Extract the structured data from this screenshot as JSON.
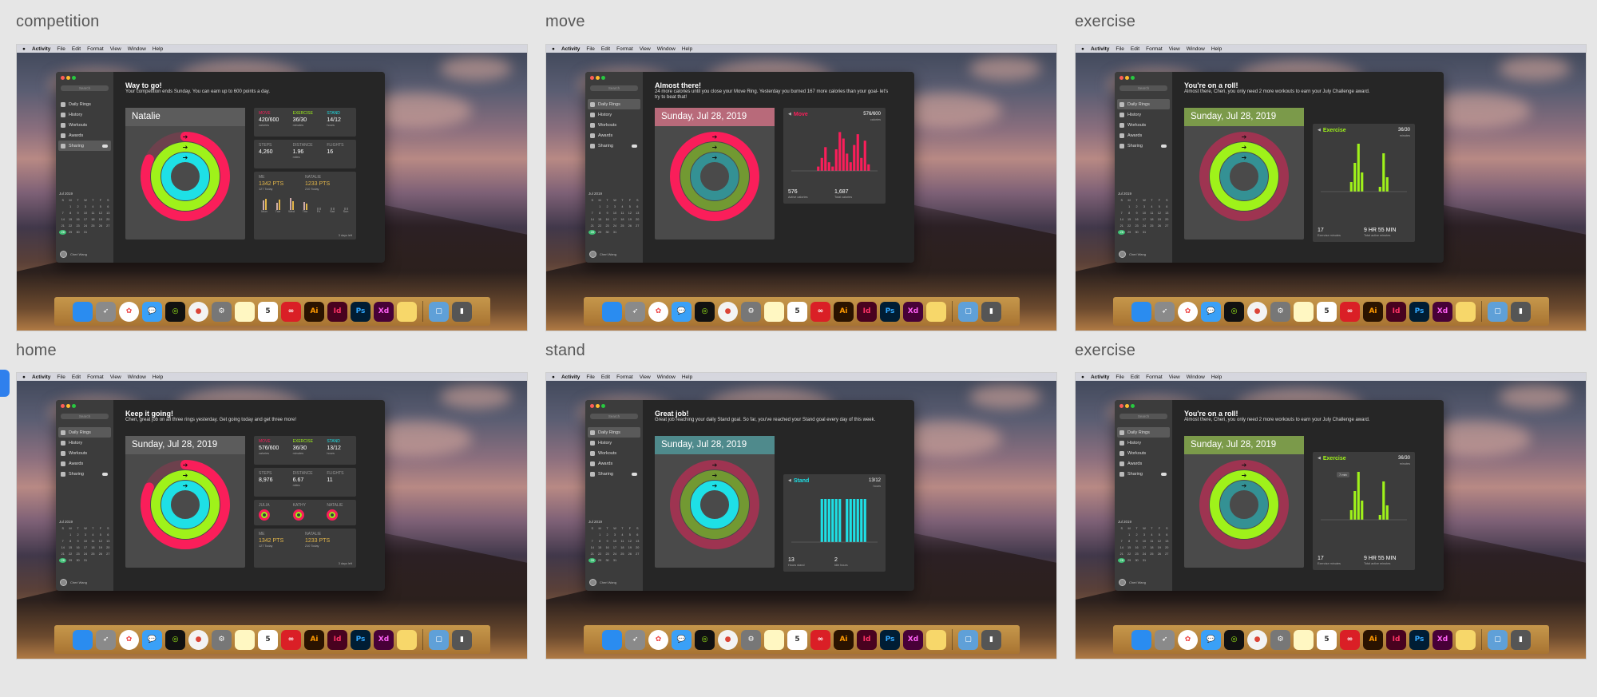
{
  "colors": {
    "move": "#fa1e5a",
    "exercise": "#9ff21a",
    "stand": "#1ee0e6",
    "window": "#262626",
    "sidebar": "#3c3c3c"
  },
  "menubar": {
    "app": "Activity",
    "items": [
      "File",
      "Edit",
      "Format",
      "View",
      "Window",
      "Help"
    ]
  },
  "sidebar": {
    "search_placeholder": "Search",
    "items": [
      {
        "label": "Daily Rings",
        "icon": "rings-icon"
      },
      {
        "label": "History",
        "icon": "history-icon"
      },
      {
        "label": "Workouts",
        "icon": "workout-icon"
      },
      {
        "label": "Awards",
        "icon": "star-icon"
      },
      {
        "label": "Sharing",
        "icon": "sharing-icon"
      }
    ],
    "calendar": {
      "month": "Jul 2019",
      "weekdays": [
        "S",
        "M",
        "T",
        "W",
        "T",
        "F",
        "S"
      ],
      "days": [
        "",
        "1",
        "2",
        "3",
        "4",
        "5",
        "6",
        "7",
        "8",
        "9",
        "10",
        "11",
        "12",
        "13",
        "14",
        "15",
        "16",
        "17",
        "18",
        "19",
        "20",
        "21",
        "22",
        "23",
        "24",
        "25",
        "26",
        "27",
        "28",
        "29",
        "30",
        "31",
        "",
        ""
      ]
    },
    "user": "Cheri Wang"
  },
  "dock": [
    "Finder",
    "Launchpad",
    "Photos",
    "Messages",
    "Activity",
    "Chrome",
    "System Preferences",
    "Notes",
    "Calendar",
    "Creative Cloud",
    "Ai",
    "Id",
    "Ps",
    "Xd",
    "Stickies",
    "Downloads",
    "Trash"
  ],
  "frames": [
    {
      "name": "competition",
      "heading": "Way to go!",
      "subtext": "Your competition ends Sunday. You can earn up to 600 points a day.",
      "card_title": "Natalie",
      "active": "Sharing",
      "metrics": [
        {
          "label": "MOVE",
          "value": "420/600",
          "unit": "calories"
        },
        {
          "label": "EXERCISE",
          "value": "36/30",
          "unit": "minutes"
        },
        {
          "label": "STAND",
          "value": "14/12",
          "unit": "hours"
        }
      ],
      "metrics2": [
        {
          "label": "STEPS",
          "value": "4,260",
          "unit": ""
        },
        {
          "label": "DISTANCE",
          "value": "1.96",
          "unit": "miles"
        },
        {
          "label": "FLIGHTS",
          "value": "16",
          "unit": ""
        }
      ],
      "competition": {
        "me_label": "ME",
        "me_pts": "1342 PTS",
        "me_today": "127 Today",
        "them_label": "NATALIE",
        "them_pts": "1233 PTS",
        "them_today": "210 Today",
        "days": [
          "Mon",
          "Tue",
          "Wed",
          "Thu",
          "Fri",
          "Sat",
          "Sun"
        ],
        "footer": "3 days left"
      }
    },
    {
      "name": "move",
      "heading": "Almost there!",
      "subtext": "24 more calories until you close your Move Ring. Yesterday you burned 167 more calories than your goal- let's try to beat that!",
      "card_title": "Sunday, Jul 28, 2019",
      "active": "Daily Rings",
      "detail": {
        "title": "Move",
        "value": "576/600",
        "unit": "calories",
        "stat1": "576",
        "stat1_label": "Active calories",
        "stat2": "1,687",
        "stat2_label": "Total calories"
      }
    },
    {
      "name": "exercise",
      "heading": "You're on a roll!",
      "subtext": "Almost there, Cheri, you only need 2 more workouts to earn your July Challenge award.",
      "card_title": "Sunday, Jul 28, 2019",
      "active": "Daily Rings",
      "detail": {
        "title": "Exercise",
        "value": "36/30",
        "unit": "minutes",
        "stat1": "17",
        "stat1_label": "Exercise minutes",
        "stat2": "9 HR 55 MIN",
        "stat2_label": "Total active minutes"
      }
    },
    {
      "name": "home",
      "heading": "Keep it going!",
      "subtext": "Cheri, great job on all three rings yesterday. Get going today and get three more!",
      "card_title": "Sunday, Jul 28, 2019",
      "active": "Daily Rings",
      "metrics": [
        {
          "label": "MOVE",
          "value": "576/600",
          "unit": "calories"
        },
        {
          "label": "EXERCISE",
          "value": "36/30",
          "unit": "minutes"
        },
        {
          "label": "STAND",
          "value": "13/12",
          "unit": "hours"
        }
      ],
      "metrics2": [
        {
          "label": "STEPS",
          "value": "8,976",
          "unit": ""
        },
        {
          "label": "DISTANCE",
          "value": "6.67",
          "unit": "miles"
        },
        {
          "label": "FLIGHTS",
          "value": "11",
          "unit": ""
        }
      ],
      "friends": [
        "JULIA",
        "KATHY",
        "NATALIE"
      ],
      "competition": {
        "me_label": "ME",
        "me_pts": "1342 PTS",
        "me_today": "127 Today",
        "them_label": "NATALIE",
        "them_pts": "1233 PTS",
        "them_today": "210 Today",
        "footer": "3 days left"
      }
    },
    {
      "name": "stand",
      "heading": "Great job!",
      "subtext": "Great job reaching your daily Stand goal. So far, you've reached your Stand goal every day of this week.",
      "card_title": "Sunday, Jul 28, 2019",
      "active": "Daily Rings",
      "detail": {
        "title": "Stand",
        "value": "13/12",
        "unit": "hours",
        "stat1": "13",
        "stat1_label": "Hours stand",
        "stat2": "2",
        "stat2_label": "Idle hours"
      }
    },
    {
      "name": "exercise",
      "heading": "You're on a roll!",
      "subtext": "Almost there, Cheri, you only need 2 more workouts to earn your July Challenge award.",
      "card_title": "Sunday, Jul 28, 2019",
      "active": "Daily Rings",
      "detail": {
        "title": "Exercise",
        "value": "36/30",
        "unit": "minutes",
        "stat1": "17",
        "stat1_label": "Exercise minutes",
        "stat2": "9 HR 55 MIN",
        "stat2_label": "Total active minutes",
        "tooltip": "7 min"
      }
    }
  ]
}
